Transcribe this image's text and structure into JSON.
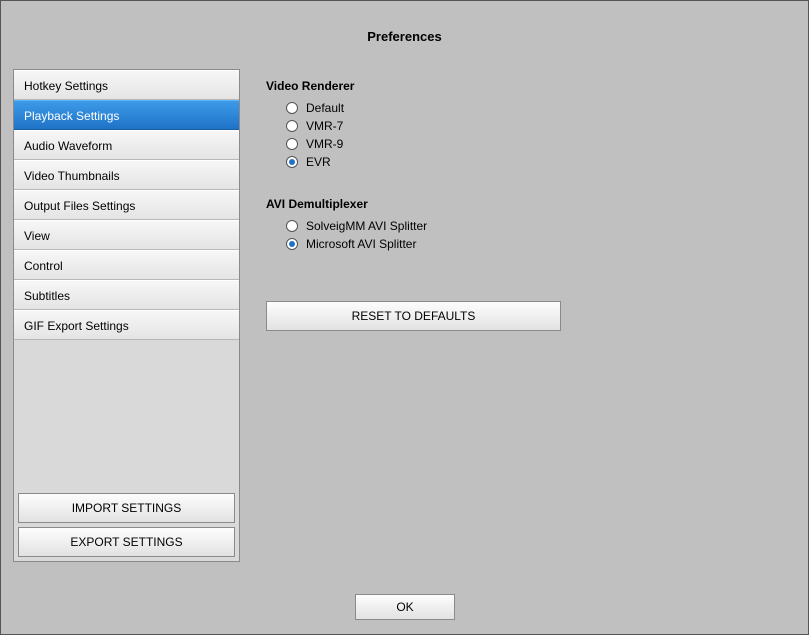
{
  "title": "Preferences",
  "sidebar": {
    "items": [
      {
        "label": "Hotkey Settings",
        "selected": false
      },
      {
        "label": "Playback Settings",
        "selected": true
      },
      {
        "label": "Audio Waveform",
        "selected": false
      },
      {
        "label": "Video Thumbnails",
        "selected": false
      },
      {
        "label": "Output Files Settings",
        "selected": false
      },
      {
        "label": "View",
        "selected": false
      },
      {
        "label": "Control",
        "selected": false
      },
      {
        "label": "Subtitles",
        "selected": false
      },
      {
        "label": "GIF Export Settings",
        "selected": false
      }
    ],
    "import_label": "IMPORT SETTINGS",
    "export_label": "EXPORT SETTINGS"
  },
  "panel": {
    "video_renderer": {
      "title": "Video Renderer",
      "options": [
        {
          "label": "Default",
          "checked": false
        },
        {
          "label": "VMR-7",
          "checked": false
        },
        {
          "label": "VMR-9",
          "checked": false
        },
        {
          "label": "EVR",
          "checked": true
        }
      ]
    },
    "avi_demux": {
      "title": "AVI Demultiplexer",
      "options": [
        {
          "label": "SolveigMM AVI Splitter",
          "checked": false
        },
        {
          "label": "Microsoft AVI Splitter",
          "checked": true
        }
      ]
    },
    "reset_label": "RESET TO DEFAULTS"
  },
  "ok_label": "OK"
}
